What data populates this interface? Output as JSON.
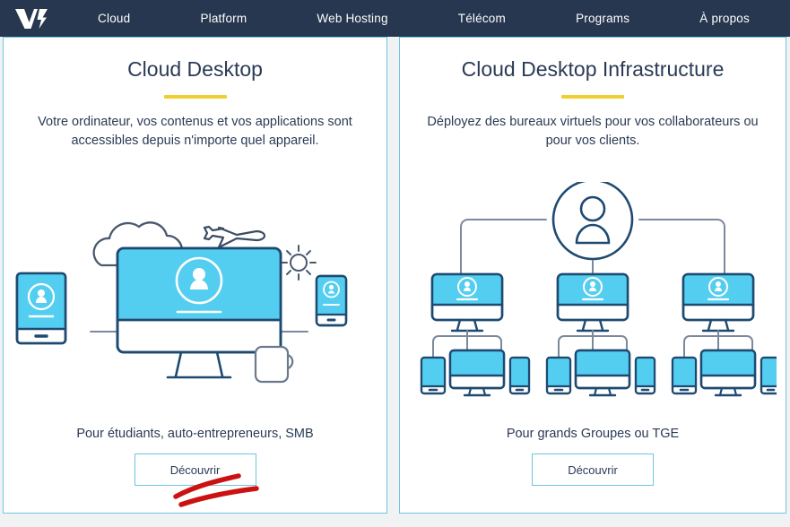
{
  "nav": {
    "logo_name": "logo-icon",
    "items": [
      {
        "label": "Cloud"
      },
      {
        "label": "Platform"
      },
      {
        "label": "Web Hosting"
      },
      {
        "label": "Télécom"
      },
      {
        "label": "Programs"
      },
      {
        "label": "À propos"
      }
    ]
  },
  "cards": [
    {
      "title": "Cloud Desktop",
      "subtitle": "Votre ordinateur, vos contenus et vos applications sont accessibles depuis n'importe quel appareil.",
      "footer": "Pour étudiants, auto-entrepreneurs, SMB",
      "button": "Découvrir"
    },
    {
      "title": "Cloud Desktop Infrastructure",
      "subtitle": "Déployez des bureaux virtuels pour vos collaborateurs ou pour vos clients.",
      "footer": "Pour grands Groupes ou TGE",
      "button": "Découvrir"
    }
  ],
  "colors": {
    "navbar": "#27374f",
    "accent_cyan": "#54cef0",
    "accent_yellow": "#efcf2e",
    "card_border": "#6dc6e0",
    "outline_navy": "#2b5581",
    "text_navy": "#2b3a55",
    "annotation_red": "#cc1111",
    "page_bg": "#f1f2f3"
  },
  "annotation": {
    "name": "red-underline-scribble",
    "target": "left-card-discover-button"
  }
}
